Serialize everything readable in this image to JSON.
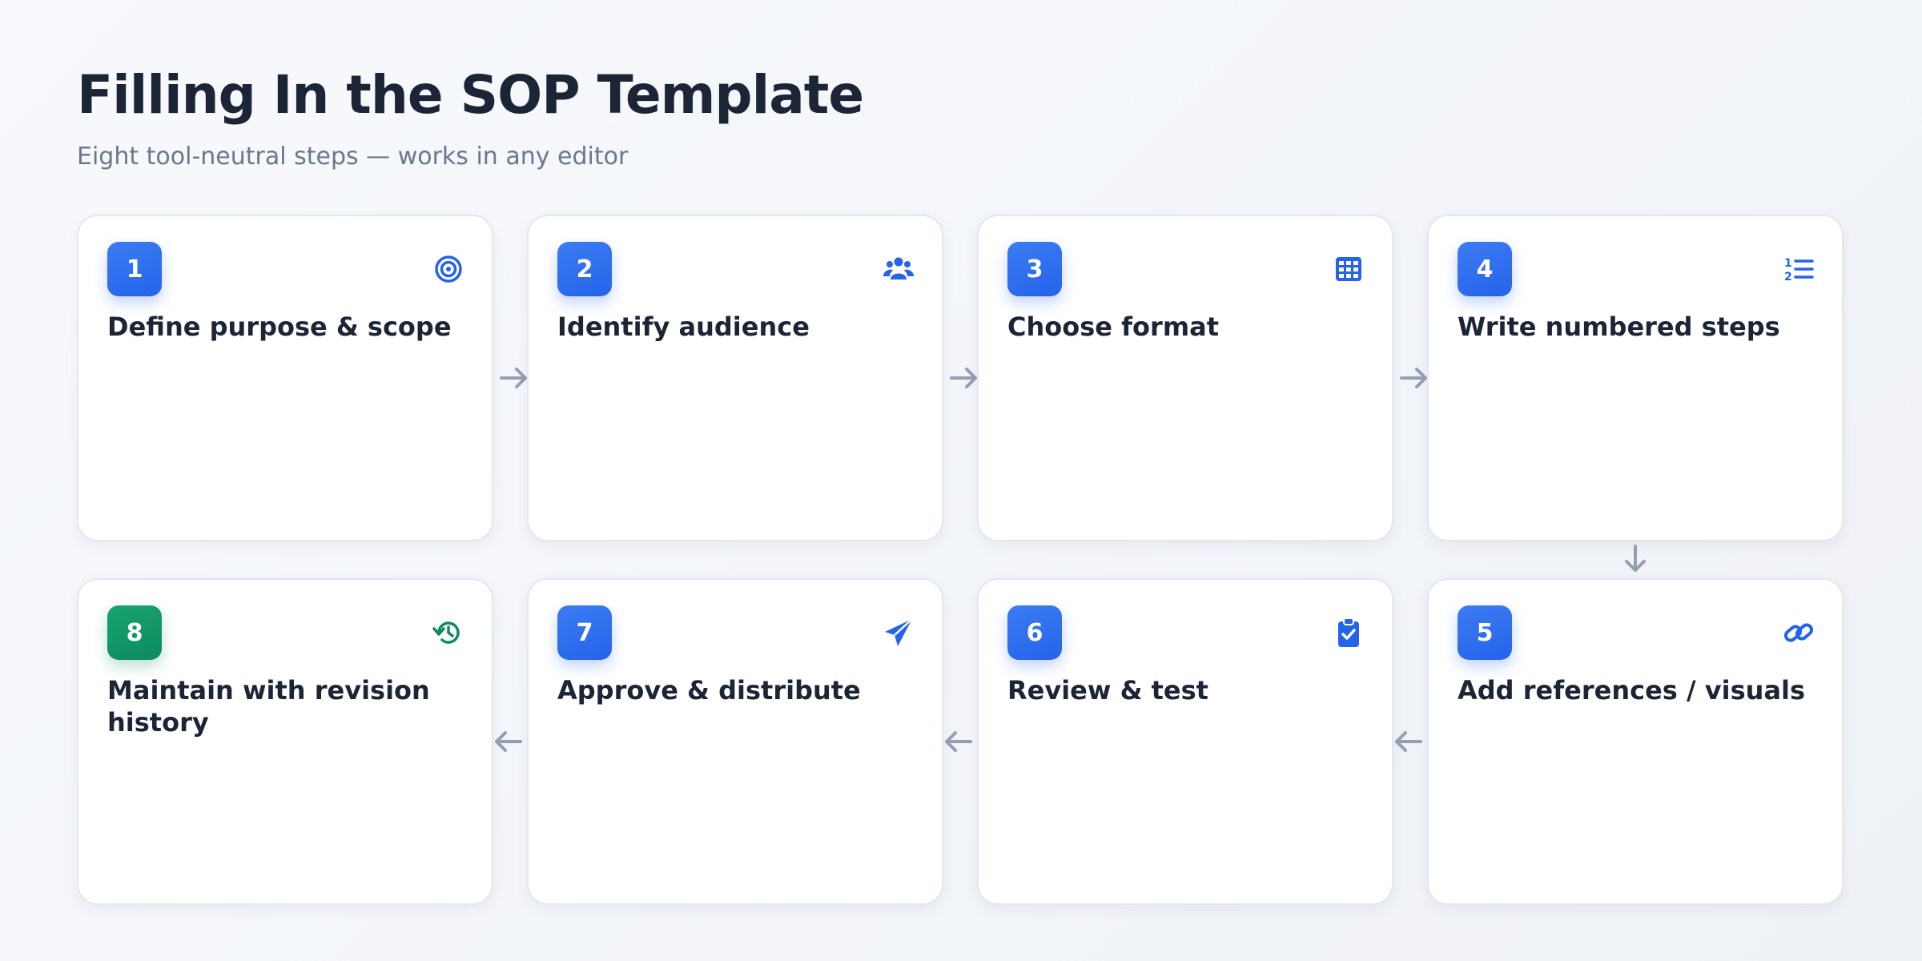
{
  "header": {
    "title": "Filling In the SOP Template",
    "subtitle": "Eight tool-neutral steps — works in any editor"
  },
  "colors": {
    "accent_blue": "#2563eb",
    "accent_green": "#0e8a5f",
    "arrow": "#94a0b2",
    "text": "#1c2536",
    "muted": "#6b778c"
  },
  "steps": [
    {
      "number": "1",
      "title": "Define purpose & scope",
      "icon": "target-icon"
    },
    {
      "number": "2",
      "title": "Identify audience",
      "icon": "users-icon"
    },
    {
      "number": "3",
      "title": "Choose format",
      "icon": "table-grid-icon"
    },
    {
      "number": "4",
      "title": "Write numbered steps",
      "icon": "numbered-list-icon"
    },
    {
      "number": "5",
      "title": "Add references / visuals",
      "icon": "link-icon"
    },
    {
      "number": "6",
      "title": "Review & test",
      "icon": "clipboard-check-icon"
    },
    {
      "number": "7",
      "title": "Approve & distribute",
      "icon": "paper-plane-icon"
    },
    {
      "number": "8",
      "title": "Maintain with revision history",
      "icon": "history-icon"
    }
  ]
}
